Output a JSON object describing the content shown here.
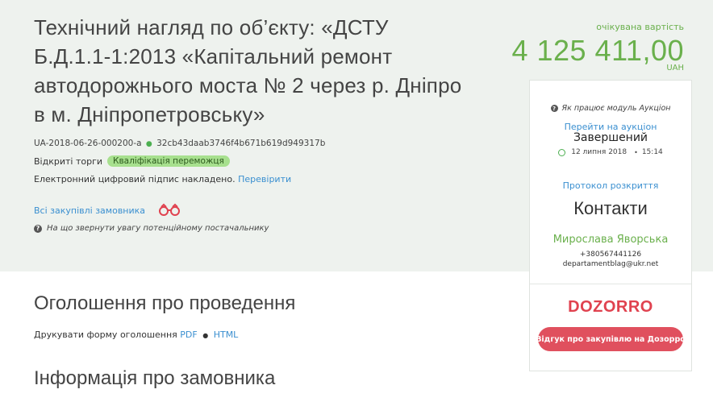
{
  "tender": {
    "title": "Технічний нагляд по об’єкту: «ДСТУ Б.Д.1.1-1:2013 «Капітальний ремонт автодорожнього моста № 2 через р. Дніпро в м. Дніпропетровську»",
    "id": "UA-2018-06-26-000200-a",
    "hash": "32cb43daab3746f4b671b619d949317b",
    "procedure": "Відкриті торги",
    "status_badge": "Кваліфікація переможця",
    "signature_text": "Електронний цифровий підпис накладено.",
    "signature_check": "Перевірити",
    "all_purchases": "Всі закупівлі замовника",
    "help_text": "На що звернути увагу потенційному постачальнику"
  },
  "price": {
    "label": "очікувана вартість",
    "value": "4 125 411,00",
    "currency": "UAH"
  },
  "sections": {
    "announcement_title": "Оголошення про проведення",
    "print_label": "Друкувати форму оголошення",
    "print_pdf": "PDF",
    "print_html": "HTML",
    "customer_title": "Інформація про замовника"
  },
  "sidebar": {
    "auction_help": "Як працює модуль Аукціон",
    "goto_auction": "Перейти на аукціон",
    "auction_status": "Завершений",
    "auction_date": "12 липня 2018",
    "auction_time": "15:14",
    "protocol": "Протокол розкриття",
    "contacts_title": "Контакти",
    "contact_name": "Мирослава Яворська",
    "contact_phone": "+380567441126",
    "contact_email": "departamentblag@ukr.net",
    "logo_text": "DOZORRO",
    "review_button": "Відгук про закупівлю на Дозорро"
  },
  "colors": {
    "accent_green": "#6ab04c",
    "link_blue": "#3a8fd0",
    "dozorro_red": "#e0424f",
    "badge_green": "#a7e08e"
  }
}
